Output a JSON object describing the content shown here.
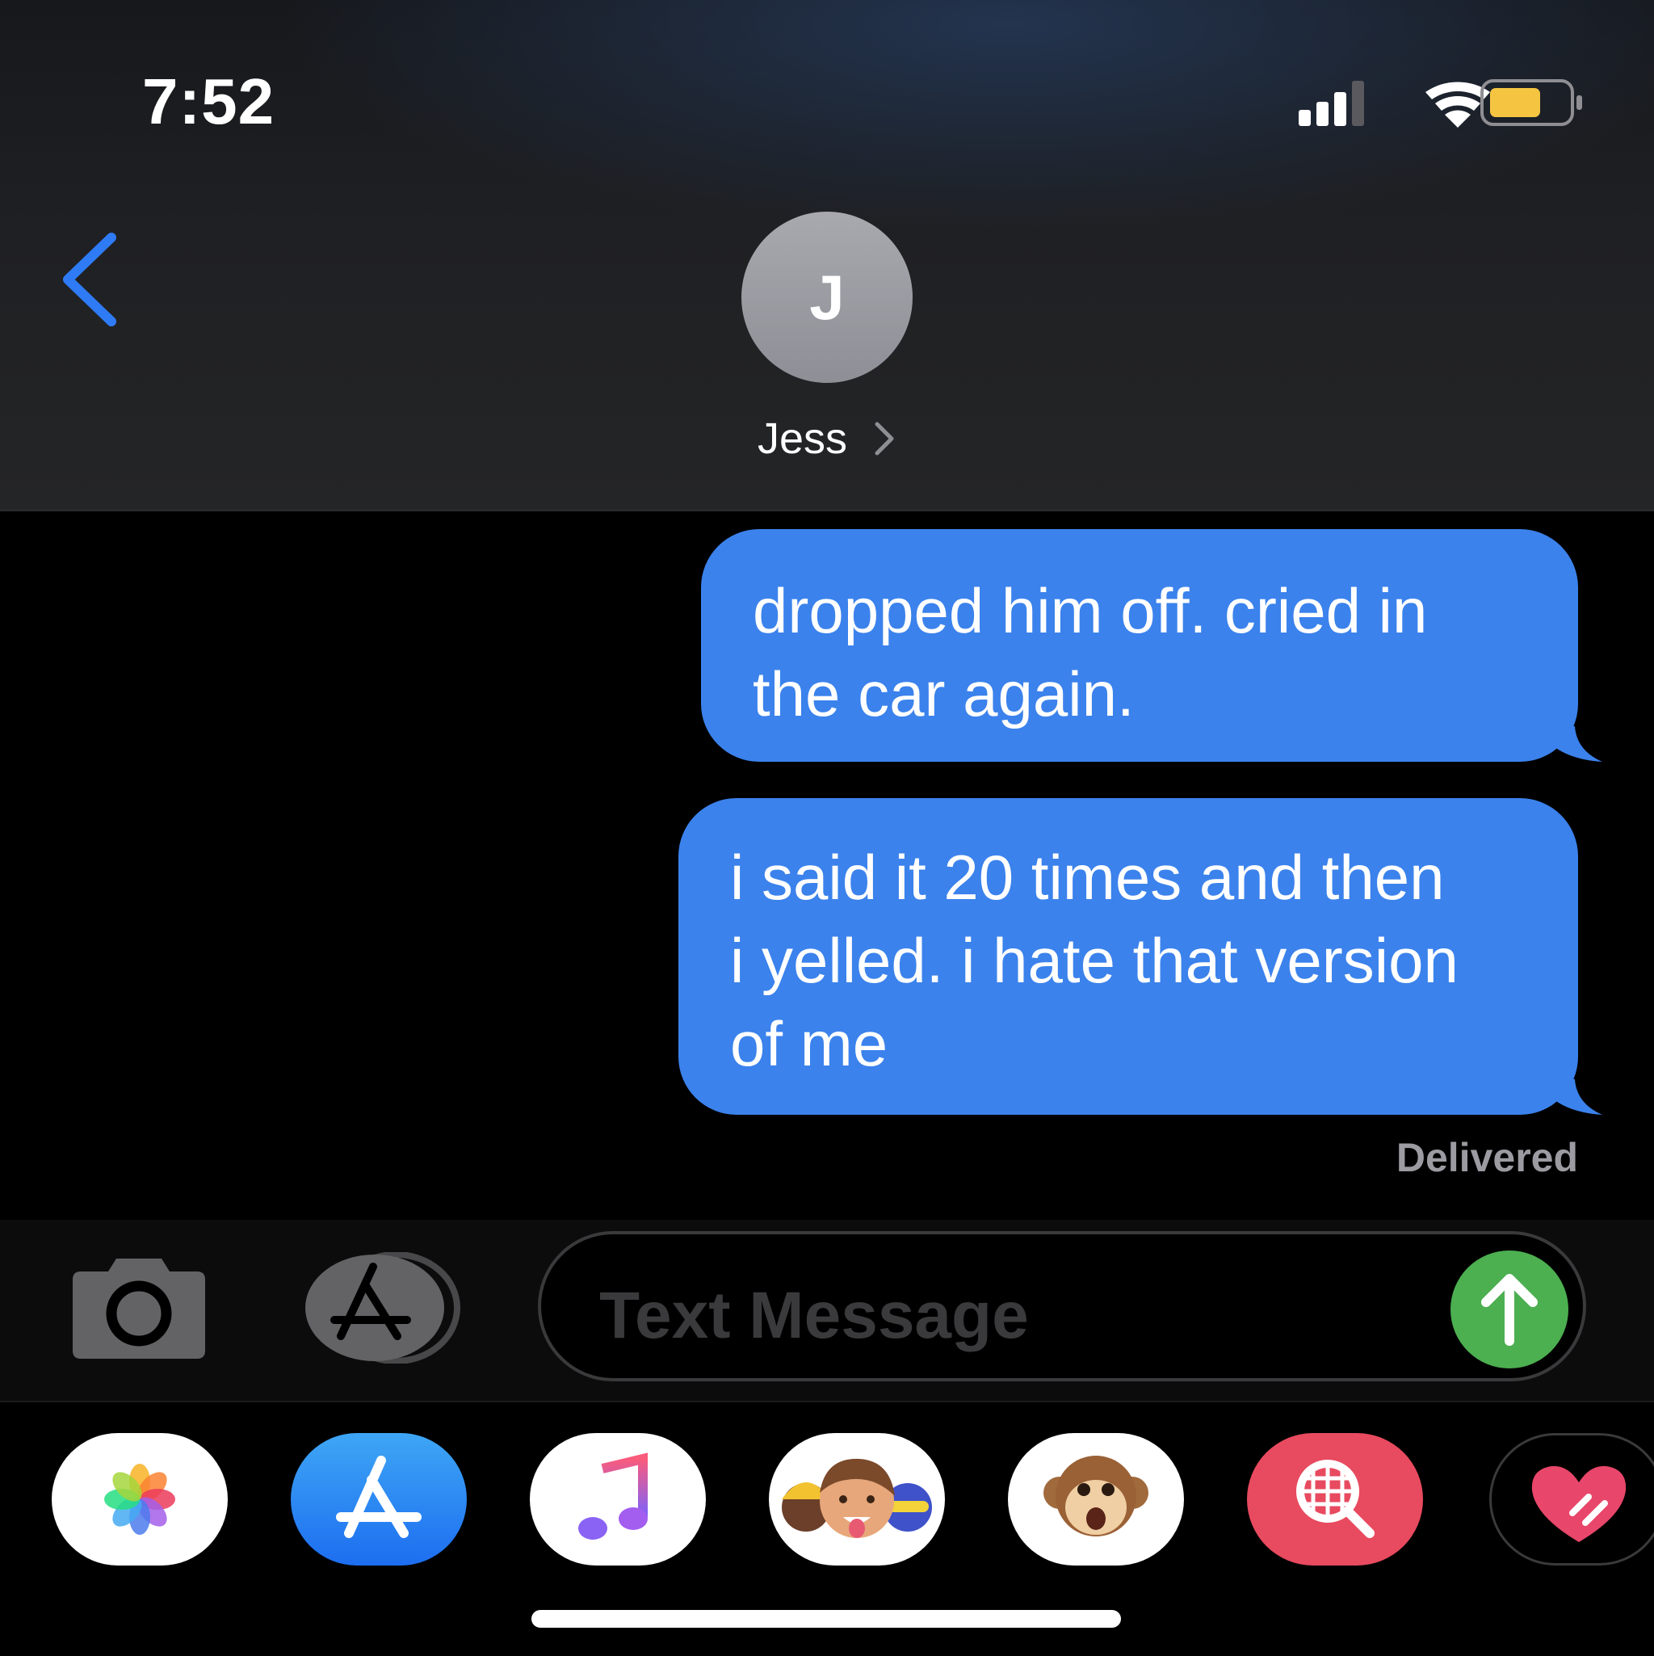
{
  "status_bar": {
    "time": "7:52",
    "icons": [
      "cellular-signal-icon",
      "wifi-icon",
      "battery-icon"
    ],
    "battery_color": "#f5c542"
  },
  "header": {
    "back_icon": "chevron-left-icon",
    "contact_initial": "J",
    "contact_name": "Jess",
    "contact_chevron_icon": "chevron-right-icon",
    "accent_color": "#2f7bf5"
  },
  "messages": [
    {
      "direction": "outgoing",
      "lines": [
        "dropped him off. cried in",
        "the car again."
      ]
    },
    {
      "direction": "outgoing",
      "lines": [
        "i said it 20 times and then",
        "i yelled. i hate that version",
        "of me"
      ]
    }
  ],
  "receipt": "Delivered",
  "compose": {
    "camera_icon": "camera-icon",
    "apps_icon": "app-store-icon",
    "placeholder": "Text Message",
    "send_icon": "arrow-up-icon",
    "send_color": "#4caf50",
    "bubble_color": "#3b82ec"
  },
  "app_drawer": {
    "apps": [
      {
        "name": "photos",
        "icon": "photos-icon"
      },
      {
        "name": "app-store",
        "icon": "app-store-icon"
      },
      {
        "name": "music",
        "icon": "music-note-icon"
      },
      {
        "name": "memoji",
        "icon": "memoji-icon"
      },
      {
        "name": "animoji",
        "icon": "monkey-icon"
      },
      {
        "name": "images-search",
        "icon": "globe-search-icon"
      },
      {
        "name": "digital-touch",
        "icon": "heart-icon"
      }
    ]
  }
}
